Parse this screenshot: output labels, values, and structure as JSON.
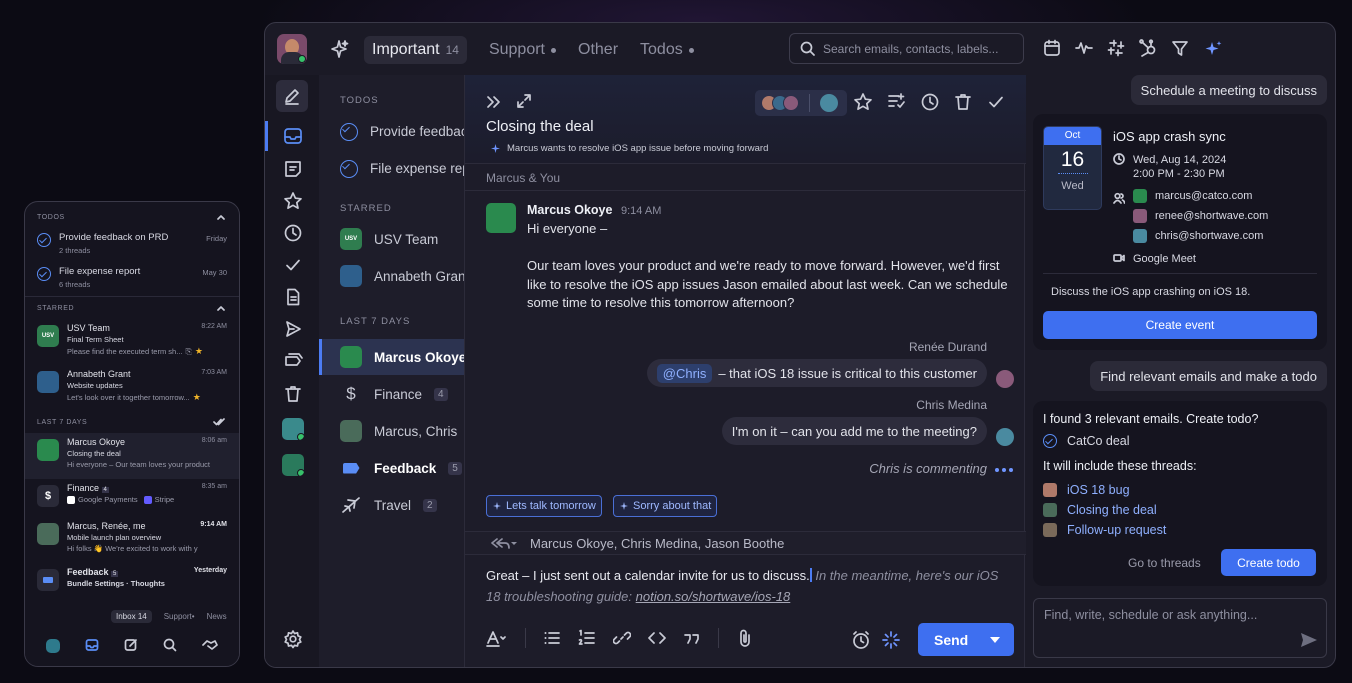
{
  "phone": {
    "todos_header": "TODOS",
    "todos": [
      {
        "title": "Provide feedback on PRD",
        "sub": "2 threads",
        "date": "Friday"
      },
      {
        "title": "File expense report",
        "sub": "6 threads",
        "date": "May 30"
      }
    ],
    "starred_header": "STARRED",
    "starred": [
      {
        "sender": "USV Team",
        "avatar": "USV",
        "time": "8:22 AM",
        "subject": "Final Term Sheet",
        "preview": "Please find the executed term sh..."
      },
      {
        "sender": "Annabeth Grant",
        "time": "7:03 AM",
        "subject": "Website updates",
        "preview": "Let's look over it together tomorrow..."
      }
    ],
    "last7_header": "LAST 7 DAYS",
    "threads": [
      {
        "sender": "Marcus Okoye",
        "time": "8:06 am",
        "subject": "Closing the deal",
        "preview": "Hi everyone – Our team loves your product"
      },
      {
        "sender": "Finance",
        "count": "4",
        "time": "8:35 am",
        "tags": [
          "Google Payments",
          "Stripe"
        ]
      },
      {
        "sender": "Marcus, Renée, me",
        "time": "9:14 AM",
        "subject": "Mobile launch plan overview",
        "preview": "Hi folks 👋 We're excited to work with y"
      },
      {
        "sender": "Feedback",
        "count": "5",
        "time": "Yesterday",
        "subject": "Bundle Settings · Thoughts"
      }
    ],
    "tabs": [
      {
        "label": "Inbox",
        "count": "14"
      },
      {
        "label": "Support"
      },
      {
        "label": "News"
      }
    ]
  },
  "topbar": {
    "tabs": [
      {
        "label": "Important",
        "count": "14"
      },
      {
        "label": "Support",
        "dot": true
      },
      {
        "label": "Other"
      },
      {
        "label": "Todos",
        "dot": true
      }
    ],
    "search_placeholder": "Search emails, contacts, labels..."
  },
  "inbox": {
    "todos_header": "TODOS",
    "todos": [
      "Provide feedback on PRD",
      "File expense report"
    ],
    "starred_header": "STARRED",
    "starred": [
      {
        "label": "USV Team",
        "avatar": "USV"
      },
      {
        "label": "Annabeth Grant"
      }
    ],
    "last7_header": "LAST 7 DAYS",
    "items": [
      {
        "label": "Marcus Okoye"
      },
      {
        "label": "Finance",
        "count": "4"
      },
      {
        "label": "Marcus, Chris"
      },
      {
        "label": "Feedback",
        "count": "5"
      },
      {
        "label": "Travel",
        "count": "2"
      }
    ]
  },
  "email": {
    "title": "Closing the deal",
    "summary": "Marcus wants to resolve iOS app issue before moving forward",
    "participants": "Marcus & You",
    "message": {
      "sender": "Marcus Okoye",
      "time": "9:14 AM",
      "greeting": "Hi everyone –",
      "body": "Our team loves your product and we're ready to move forward. However, we'd first like to resolve the iOS app issues Jason emailed about last week. Can we schedule some time to resolve this tomorrow afternoon?"
    },
    "comments": [
      {
        "author": "Renée Durand",
        "mention": "@Chris",
        "text": "– that iOS 18 issue is critical to this customer"
      },
      {
        "author": "Chris Medina",
        "text": "I'm on it – can you add me to the meeting?"
      }
    ],
    "typing": "Chris is commenting",
    "suggestions": [
      "Lets talk tomorrow",
      "Sorry about that"
    ],
    "reply_to": "Marcus Okoye, Chris Medina, Jason Boothe",
    "draft": "Great – I just sent out a calendar invite for us to discuss.",
    "draft_suggestion": "In the meantime, here's our iOS 18 troubleshooting guide:",
    "draft_link": "notion.so/shortwave/ios-18",
    "send_label": "Send"
  },
  "assistant": {
    "prompt1": "Schedule a meeting to discuss",
    "event": {
      "month": "Oct",
      "day": "16",
      "weekday": "Wed",
      "title": "iOS app crash sync",
      "date": "Wed, Aug 14, 2024",
      "time": "2:00 PM - 2:30 PM",
      "attendees": [
        "marcus@catco.com",
        "renee@shortwave.com",
        "chris@shortwave.com"
      ],
      "location": "Google Meet",
      "description": "Discuss the iOS app crashing on iOS 18.",
      "button": "Create event"
    },
    "prompt2": "Find relevant emails and make a todo",
    "todo": {
      "intro": "I found 3 relevant emails. Create todo?",
      "name": "CatCo deal",
      "include": "It will include these threads:",
      "threads": [
        "iOS 18 bug",
        "Closing the deal",
        "Follow-up request"
      ],
      "secondary": "Go to threads",
      "primary": "Create todo"
    },
    "ask_placeholder": "Find, write, schedule or ask anything..."
  },
  "colors": {
    "accent": "#3e6ff0",
    "background": "#1b1a26",
    "online": "#37c16a",
    "star": "#f0b429"
  }
}
